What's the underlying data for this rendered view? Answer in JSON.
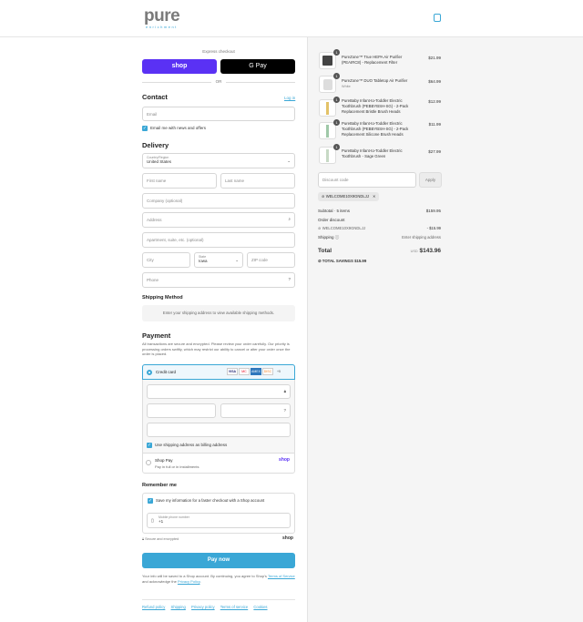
{
  "brand": {
    "logo": "pure",
    "sub": "enrichment"
  },
  "express": {
    "title": "Express checkout",
    "shop": "shop",
    "gpay": "G Pay",
    "or": "OR"
  },
  "contact": {
    "title": "Contact",
    "login": "Log in",
    "email_placeholder": "Email",
    "newsletter": "Email me with news and offers"
  },
  "delivery": {
    "title": "Delivery",
    "country_label": "Country/Region",
    "country": "United States",
    "first": "First name",
    "last": "Last name",
    "company": "Company (optional)",
    "address": "Address",
    "apt": "Apartment, suite, etc. (optional)",
    "city": "City",
    "state_label": "State",
    "state": "Iowa",
    "zip": "ZIP code",
    "phone": "Phone"
  },
  "shipping": {
    "title": "Shipping Method",
    "note": "Enter your shipping address to view available shipping methods."
  },
  "payment": {
    "title": "Payment",
    "note": "All transactions are secure and encrypted. Please review your order carefully. Our priority is processing orders swiftly, which may restrict our ability to cancel or alter your order once the order is placed.",
    "card": "Credit card",
    "card_logos": [
      "VISA",
      "MC",
      "AMEX",
      "DISC",
      "+5"
    ],
    "billing": "Use shipping address as billing address",
    "shoppay": "Shop Pay",
    "shoppay_sub": "Pay in full or in installments",
    "shoppay_logo": "shop"
  },
  "remember": {
    "title": "Remember me",
    "save": "Save my information for a faster checkout with a Shop account",
    "mobile_label": "Mobile phone number",
    "mobile_value": "+1",
    "secure": "Secure and encrypted",
    "shop": "shop"
  },
  "pay_button": "Pay now",
  "legal": {
    "pre": "Your info will be saved to a Shop account. By continuing, you agree to Shop's",
    "terms": "Terms of Service",
    "mid": "and acknowledge the",
    "privacy": "Privacy Policy",
    "end": "."
  },
  "footer": [
    "Refund policy",
    "Shipping",
    "Privacy policy",
    "Terms of service",
    "Cookies"
  ],
  "items": [
    {
      "title": "PureZone™ True HEPA Air Purifier (PEAIRC8) - Replacement Filter",
      "sub": "",
      "price": "$21.99",
      "qty": "1"
    },
    {
      "title": "PureZone™ DUO Tabletop Air Purifier",
      "sub": "White",
      "price": "$64.99",
      "qty": "1"
    },
    {
      "title": "PureBaby Infant-to-Toddler Electric Toothbrush (PEBBYBSH-SG) - 2-Pack Replacement Bristle Brush Heads",
      "sub": "",
      "price": "$12.99",
      "qty": "1"
    },
    {
      "title": "PureBaby Infant-to-Toddler Electric Toothbrush (PEBBYBSH-SG) - 2-Pack Replacement Silicone Brush Heads",
      "sub": "",
      "price": "$11.99",
      "qty": "1"
    },
    {
      "title": "PureBaby Infant-to-Toddler Electric Toothbrush - Sage Green",
      "sub": "",
      "price": "$27.99",
      "qty": "1"
    }
  ],
  "discount": {
    "placeholder": "Discount code",
    "apply": "Apply",
    "code": "WELCOME10X9GNDLJJ"
  },
  "summary": {
    "subtotal_label": "Subtotal · 5 items",
    "subtotal": "$159.95",
    "order_discount": "Order discount",
    "code": "WELCOME10X9GNDLJJ",
    "discount": "- $15.99",
    "shipping_label": "Shipping",
    "shipping": "Enter shipping address",
    "total_label": "Total",
    "currency": "USD",
    "total": "$143.96",
    "savings_label": "TOTAL SAVINGS",
    "savings": "$15.99"
  }
}
